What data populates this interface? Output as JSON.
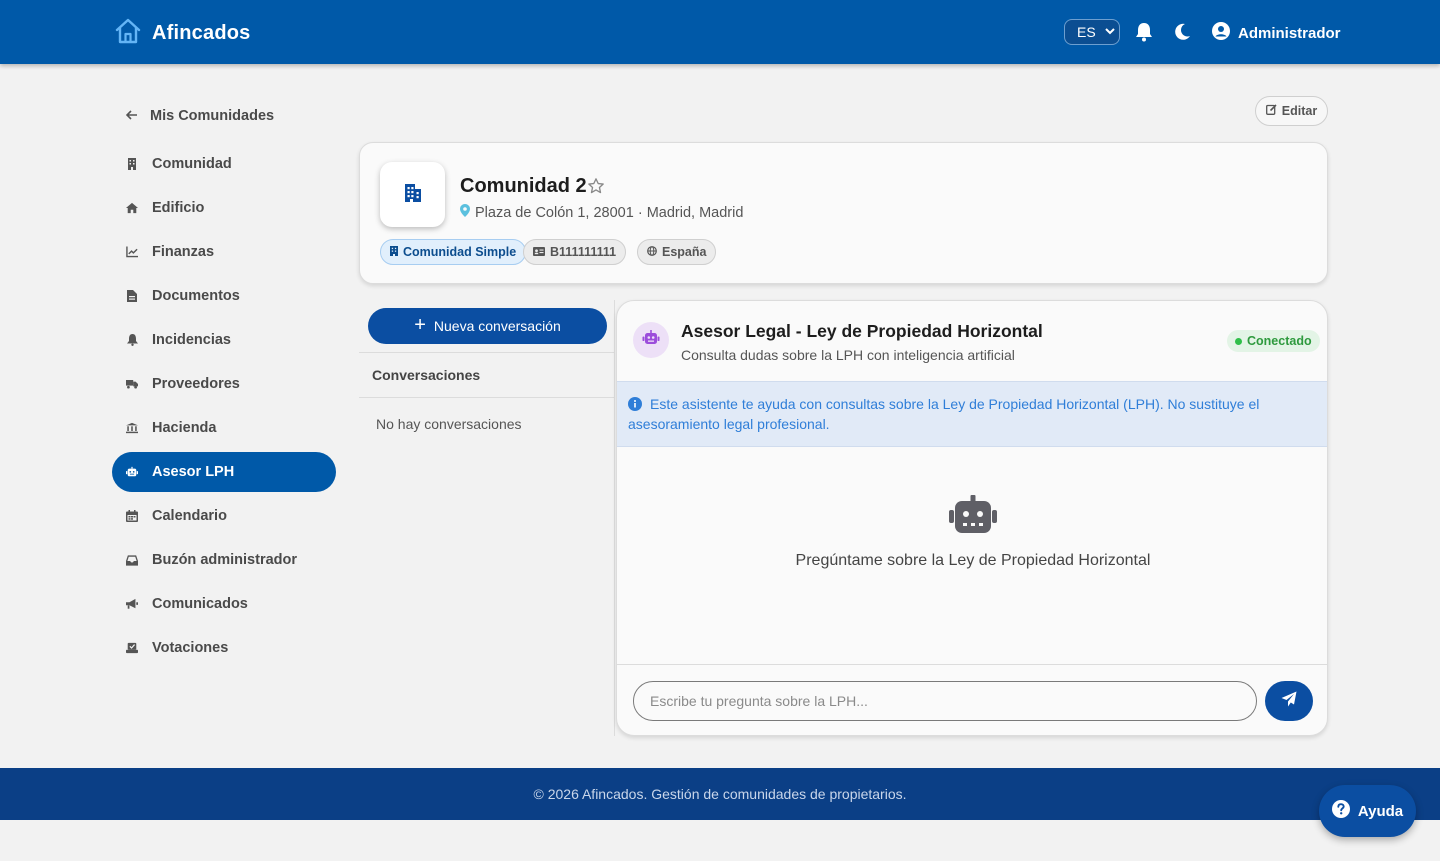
{
  "app": {
    "name": "Afincados"
  },
  "header": {
    "language": "ES",
    "user": "Administrador"
  },
  "sidebar": {
    "back_label": "Mis Comunidades",
    "items": [
      {
        "label": "Comunidad",
        "icon": "building-icon"
      },
      {
        "label": "Edificio",
        "icon": "home-icon"
      },
      {
        "label": "Finanzas",
        "icon": "chart-line-icon"
      },
      {
        "label": "Documentos",
        "icon": "document-icon"
      },
      {
        "label": "Incidencias",
        "icon": "bell-icon"
      },
      {
        "label": "Proveedores",
        "icon": "truck-icon"
      },
      {
        "label": "Hacienda",
        "icon": "bank-icon"
      },
      {
        "label": "Asesor LPH",
        "icon": "robot-icon",
        "active": true
      },
      {
        "label": "Calendario",
        "icon": "calendar-icon"
      },
      {
        "label": "Buzón administrador",
        "icon": "inbox-icon"
      },
      {
        "label": "Comunicados",
        "icon": "megaphone-icon"
      },
      {
        "label": "Votaciones",
        "icon": "ballot-icon"
      }
    ]
  },
  "actions": {
    "edit_label": "Editar"
  },
  "community": {
    "name": "Comunidad 2",
    "address": "Plaza de Colón 1, 28001 · Madrid, Madrid",
    "type_chip": "Comunidad Simple",
    "cif_chip": "B111111111",
    "country_chip": "España"
  },
  "conversations": {
    "new_label": "Nueva conversación",
    "title": "Conversaciones",
    "empty": "No hay conversaciones"
  },
  "chat": {
    "title": "Asesor Legal - Ley de Propiedad Horizontal",
    "subtitle": "Consulta dudas sobre la LPH con inteligencia artificial",
    "status": "Conectado",
    "info": "Este asistente te ayuda con consultas sobre la Ley de Propiedad Horizontal (LPH). No sustituye el asesoramiento legal profesional.",
    "empty_prompt": "Pregúntame sobre la Ley de Propiedad Horizontal",
    "input_placeholder": "Escribe tu pregunta sobre la LPH..."
  },
  "footer": {
    "text": "© 2026 Afincados. Gestión de comunidades de propietarios."
  },
  "help": {
    "label": "Ayuda"
  },
  "colors": {
    "primary": "#0059a8",
    "button": "#0b4ea2",
    "footer": "#0b3f86",
    "success": "#2fbf49",
    "info": "#2f7ed8"
  }
}
